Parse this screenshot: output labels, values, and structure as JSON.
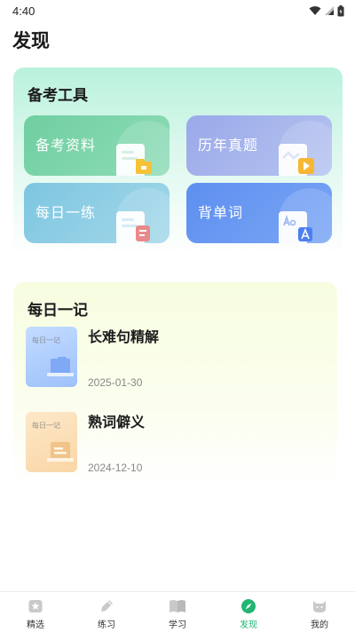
{
  "status": {
    "time": "4:40"
  },
  "page_title": "发现",
  "tools": {
    "title": "备考工具",
    "items": [
      {
        "label": "备考资料",
        "icon": "folder-icon",
        "accent": "#f6c238"
      },
      {
        "label": "历年真题",
        "icon": "play-icon",
        "accent": "#f7b733"
      },
      {
        "label": "每日一练",
        "icon": "document-icon",
        "accent": "#e98a8a"
      },
      {
        "label": "背单词",
        "icon": "letter-icon",
        "accent": "#4d7ff0"
      }
    ]
  },
  "notes": {
    "title": "每日一记",
    "items": [
      {
        "thumb_caption": "每日一记",
        "title": "长难句精解",
        "date": "2025-01-30"
      },
      {
        "thumb_caption": "每日一记",
        "title": "熟词僻义",
        "date": "2024-12-10"
      }
    ]
  },
  "nav": {
    "items": [
      {
        "label": "精选",
        "active": false
      },
      {
        "label": "练习",
        "active": false
      },
      {
        "label": "学习",
        "active": false
      },
      {
        "label": "发现",
        "active": true
      },
      {
        "label": "我的",
        "active": false
      }
    ]
  },
  "colors": {
    "brand_green": "#22b573"
  }
}
